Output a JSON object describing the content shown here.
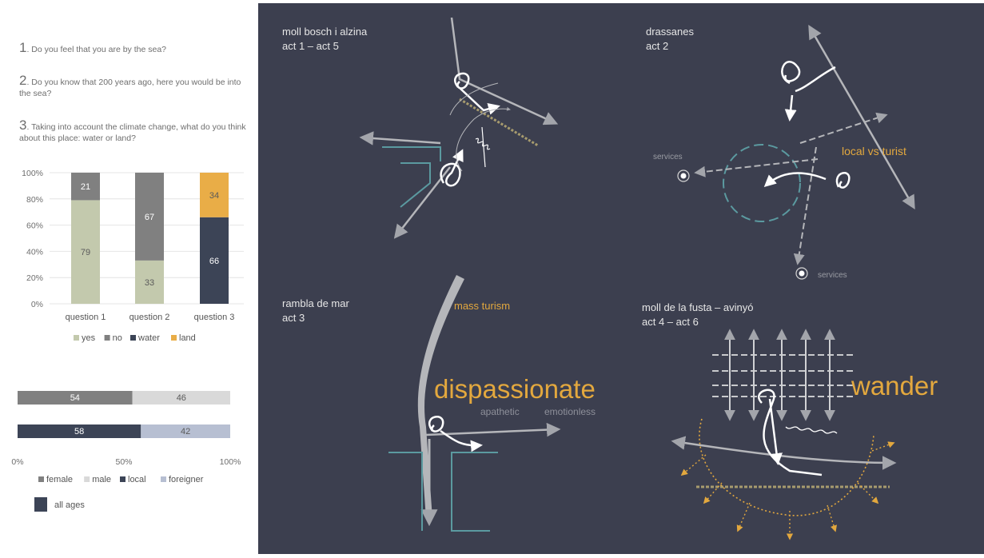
{
  "questions": [
    {
      "num": "1",
      "text": ". Do you feel that you are by the sea?"
    },
    {
      "num": "2",
      "text": ". Do you know that 200 years ago, here you would be into the sea?"
    },
    {
      "num": "3",
      "text": ". Taking into account the climate change, what do you think about this place: water or land?"
    }
  ],
  "colors": {
    "yes": "#c3c9ad",
    "no": "#808080",
    "water": "#3c4456",
    "land": "#e9ad47",
    "female": "#808080",
    "male": "#d9d9d9",
    "local": "#3c4456",
    "foreigner": "#b7bfd2",
    "panel": "#3c3f4f",
    "accent": "#e3a83e",
    "teal": "#5b9aa0"
  },
  "chart_data": [
    {
      "type": "bar",
      "stacked": true,
      "categories": [
        "question 1",
        "question 2",
        "question 3"
      ],
      "series": [
        {
          "name": "yes",
          "values": [
            79,
            33,
            0
          ]
        },
        {
          "name": "no",
          "values": [
            21,
            67,
            0
          ]
        },
        {
          "name": "water",
          "values": [
            0,
            0,
            66
          ]
        },
        {
          "name": "land",
          "values": [
            0,
            0,
            34
          ]
        }
      ],
      "yticks": [
        "0%",
        "20%",
        "40%",
        "60%",
        "80%",
        "100%"
      ],
      "ylim": [
        0,
        100
      ],
      "legend": [
        "yes",
        "no",
        "water",
        "land"
      ],
      "legend_position": "bottom"
    },
    {
      "type": "bar",
      "orientation": "horizontal",
      "stacked": true,
      "rows": [
        {
          "labels": [
            "female",
            "male"
          ],
          "values": [
            54,
            46
          ]
        },
        {
          "labels": [
            "local",
            "foreigner"
          ],
          "values": [
            58,
            42
          ]
        }
      ],
      "xticks": [
        "0%",
        "50%",
        "100%"
      ],
      "xlim": [
        0,
        100
      ],
      "legend": [
        "female",
        "male",
        "local",
        "foreigner"
      ],
      "legend_position": "bottom"
    }
  ],
  "ages_legend": "all ages",
  "panels": [
    {
      "title": "moll bosch i alzina",
      "subtitle": "act 1 – act 5"
    },
    {
      "title": "drassanes",
      "subtitle": "act 2"
    },
    {
      "title": "rambla de mar",
      "subtitle": "act 3"
    },
    {
      "title": "moll de la fusta – avinyó",
      "subtitle": "act 4 – act 6"
    }
  ],
  "labels": {
    "services_1": "services",
    "services_2": "services",
    "local_vs_turist": "local vs turist",
    "mass_turism": "mass turism",
    "dispassionate": "dispassionate",
    "apathetic": "apathetic",
    "emotionless": "emotionless",
    "wander": "wander"
  }
}
